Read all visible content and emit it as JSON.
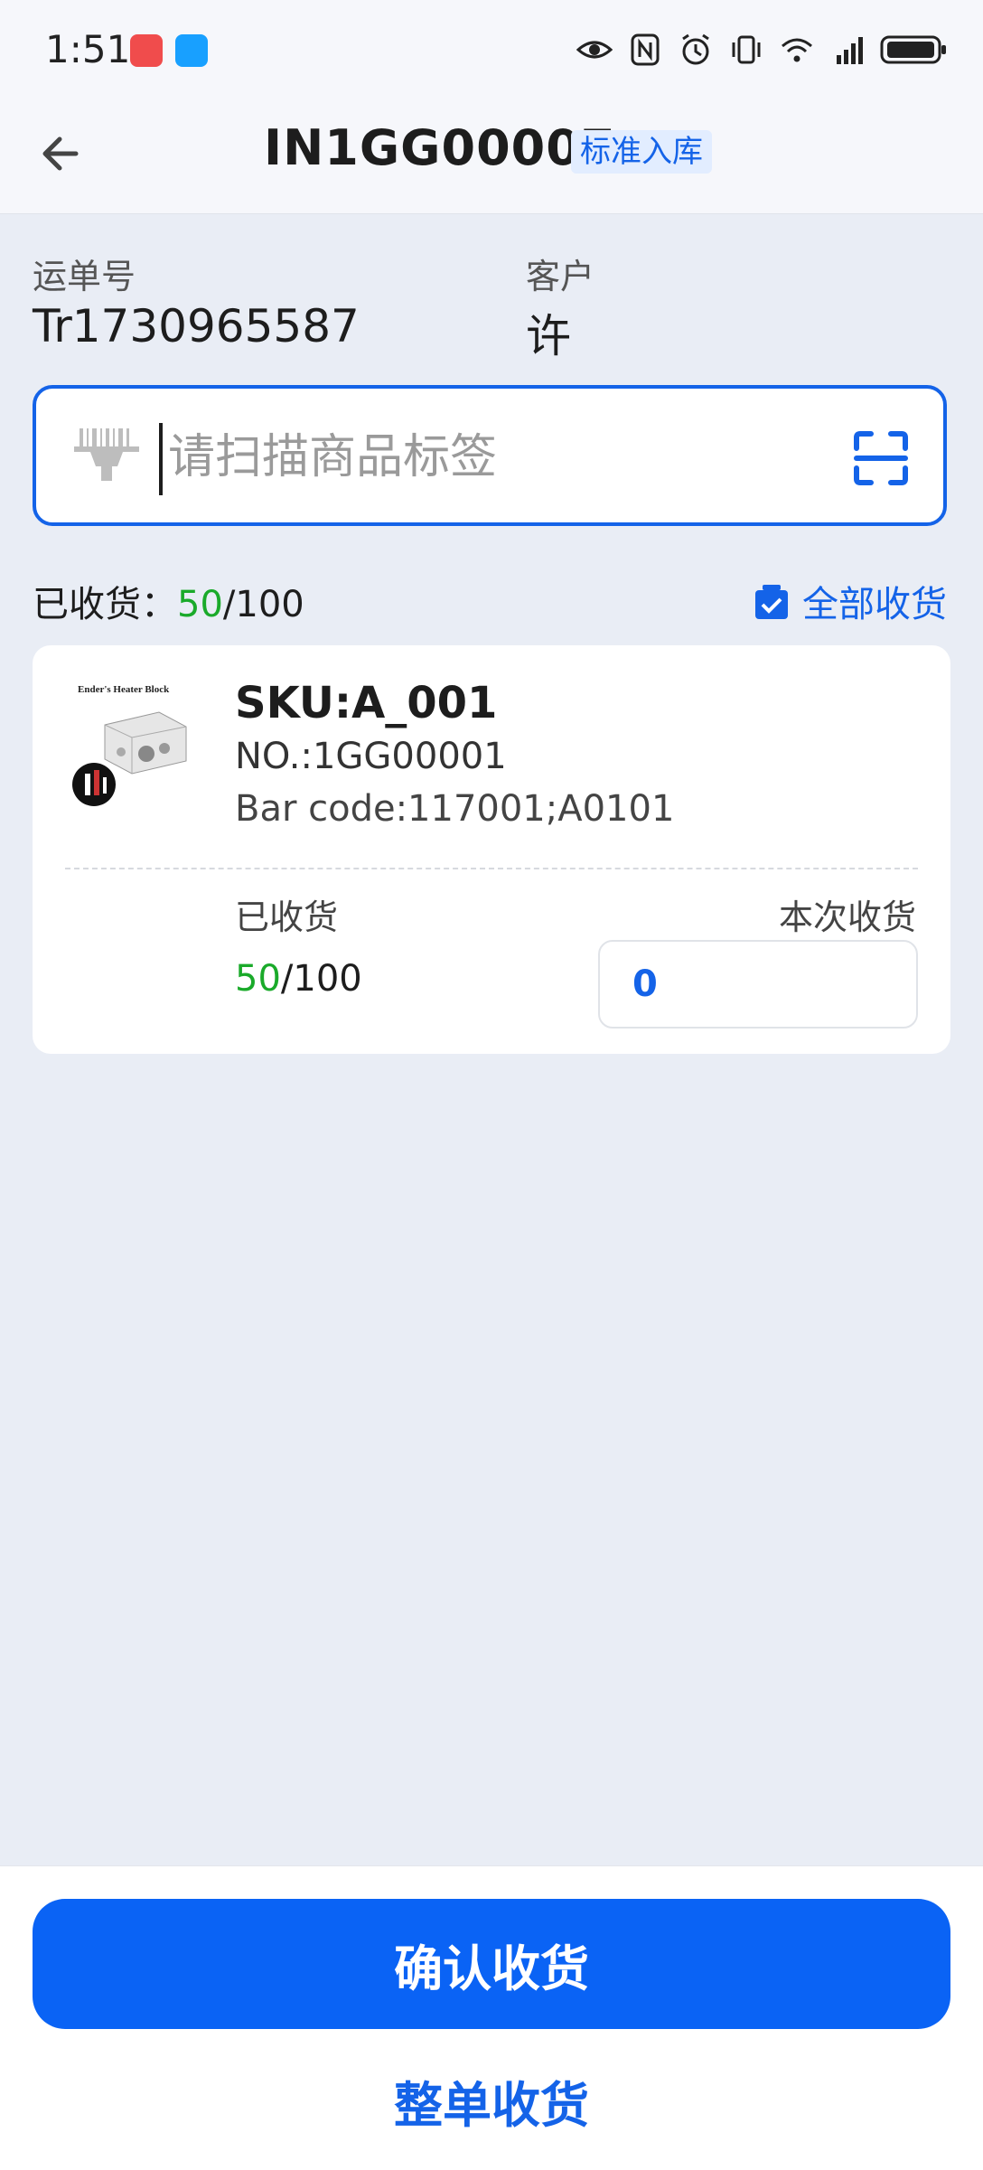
{
  "status_bar": {
    "time": "1:51",
    "icons": [
      "huawei-app-icon",
      "cloud-app-icon",
      "eye-icon",
      "nfc-icon",
      "alarm-icon",
      "vibrate-icon",
      "wifi-icon",
      "signal-4g-icon",
      "battery-icon"
    ]
  },
  "header": {
    "order_no": "IN1GG00007",
    "order_type": "标准入库"
  },
  "info": {
    "waybill_label": "运单号",
    "waybill_value": "Tr1730965587",
    "customer_label": "客户",
    "customer_value": "许"
  },
  "scan": {
    "placeholder": "请扫描商品标签",
    "value": ""
  },
  "summary": {
    "label": "已收货：",
    "received": "50",
    "total": "/100",
    "receive_all_label": "全部收货"
  },
  "item": {
    "sku": "SKU:A_001",
    "no": "NO.:1GG00001",
    "barcode": "Bar code:117001;A0101",
    "received_label": "已收货",
    "received": "50",
    "total": "/100",
    "current_label": "本次收货",
    "current_qty": "0",
    "thumb_title": "Ender's Heater Block"
  },
  "footer": {
    "confirm_label": "确认收货",
    "whole_label": "整单收货"
  },
  "colors": {
    "accent": "#0a63f5",
    "green": "#1aaa2a",
    "background": "#e9edf5"
  }
}
